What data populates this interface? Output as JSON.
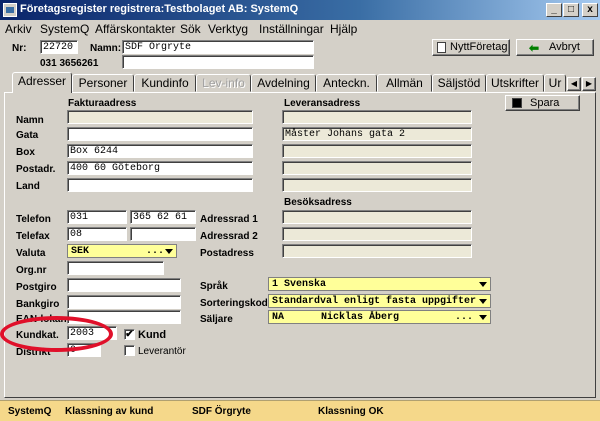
{
  "window": {
    "title": "Företagsregister registrera:Testbolaget AB: SystemQ",
    "min": "_",
    "max": "□",
    "close": "x"
  },
  "menu": [
    "Arkiv",
    "SystemQ",
    "Affärskontakter",
    "Sök",
    "Verktyg",
    "Inställningar",
    "Hjälp"
  ],
  "header": {
    "nr_label": "Nr:",
    "nr_value": "22720",
    "phone": "031 3656261",
    "namn_label": "Namn:",
    "namn_value": "SDF Örgryte",
    "new_company_button": "NyttFöretag",
    "cancel_button": "Avbryt"
  },
  "tabs": [
    "Adresser",
    "Personer",
    "Kundinfo",
    "Lev-info",
    "Avdelning",
    "Anteckn.",
    "Allmän",
    "Säljstöd",
    "Utskrifter",
    "Ur"
  ],
  "active_tab": "Adresser",
  "save_button": "Spara",
  "fakturaadress": {
    "title": "Fakturaadress",
    "namn_label": "Namn",
    "gata_label": "Gata",
    "gata_value": "",
    "box_label": "Box",
    "box_value": "Box 6244",
    "postadr_label": "Postadr.",
    "postadr_value": "400 60 Göteborg",
    "land_label": "Land",
    "land_value": ""
  },
  "leveransadress": {
    "title": "Leveransadress",
    "namn_value": "",
    "gata_value": "Måster Johans gata 2",
    "box_value": "",
    "postadr_value": "",
    "land_value": ""
  },
  "besoksadress": {
    "title": "Besöksadress",
    "adressrad1_label": "Adressrad 1",
    "adressrad2_label": "Adressrad 2",
    "postadress_label": "Postadress"
  },
  "contact": {
    "telefon_label": "Telefon",
    "telefon_area": "031",
    "telefon_number": "365 62 61",
    "telefax_label": "Telefax",
    "telefax_area": "08",
    "telefax_number": "",
    "valuta_label": "Valuta",
    "valuta_value": "SEK",
    "valuta_dots": "...",
    "orgnr_label": "Org.nr",
    "postgiro_label": "Postgiro",
    "bankgiro_label": "Bankgiro",
    "ean_label": "EAN-lokan",
    "kundkat_label": "Kundkat.",
    "kundkat_value": "2003",
    "distrikt_label": "Distrikt",
    "distrikt_value": "0"
  },
  "right_fields": {
    "sprak_label": "Språk",
    "sprak_value": "1 Svenska",
    "sorteringskod_label": "Sorteringskod",
    "sorteringskod_value": "Standardval enligt fasta uppgifter",
    "saljare_label": "Säljare",
    "saljare_code": "NA",
    "saljare_name": "Nicklas Åberg",
    "saljare_dots": "..."
  },
  "checkboxes": {
    "kund_label": "Kund",
    "kund_checked": true,
    "kund_mark": "✔",
    "leverantor_label": "Leverantör",
    "leverantor_checked": false
  },
  "status": {
    "app": "SystemQ",
    "message": "Klassning av kund",
    "company": "SDF Örgryte",
    "result": "Klassning OK"
  },
  "colors": {
    "required_field": "#ffff99",
    "status_bar": "#f5d88a",
    "highlight": "#e0102a"
  }
}
